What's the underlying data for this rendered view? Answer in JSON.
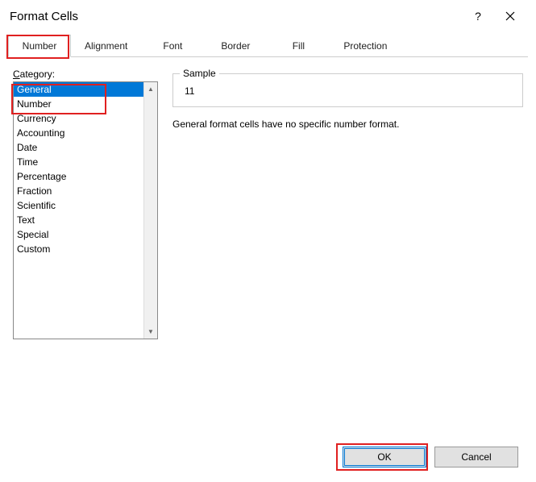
{
  "titlebar": {
    "title": "Format Cells",
    "help": "?",
    "close": "✕"
  },
  "tabs": {
    "items": [
      {
        "label": "Number"
      },
      {
        "label": "Alignment"
      },
      {
        "label": "Font"
      },
      {
        "label": "Border"
      },
      {
        "label": "Fill"
      },
      {
        "label": "Protection"
      }
    ]
  },
  "category": {
    "label_pre": "C",
    "label_rest": "ategory:",
    "items": [
      "General",
      "Number",
      "Currency",
      "Accounting",
      "Date",
      "Time",
      "Percentage",
      "Fraction",
      "Scientific",
      "Text",
      "Special",
      "Custom"
    ]
  },
  "sample": {
    "legend": "Sample",
    "value": "11"
  },
  "description": "General format cells have no specific number format.",
  "buttons": {
    "ok": "OK",
    "cancel": "Cancel"
  }
}
